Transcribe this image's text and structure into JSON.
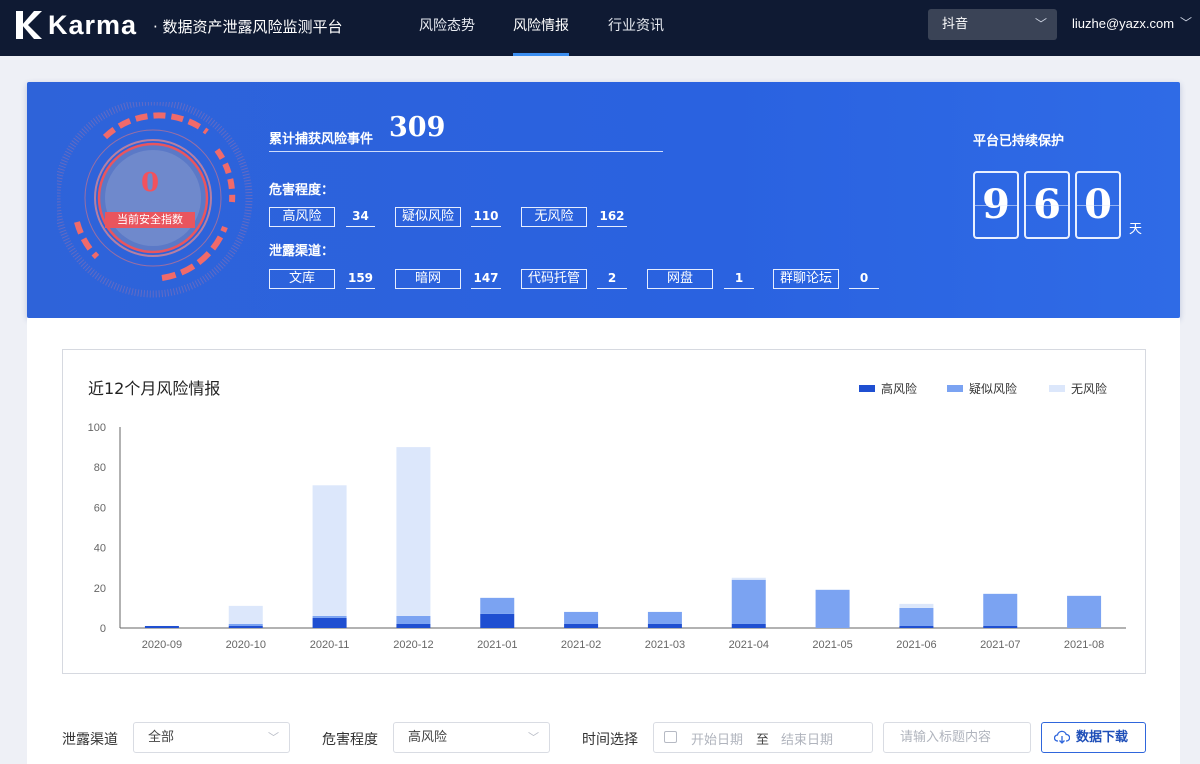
{
  "header": {
    "brand": "Karma",
    "subtitle": "· 数据资产泄露风险监测平台",
    "nav": [
      {
        "label": "风险态势",
        "active": false
      },
      {
        "label": "风险情报",
        "active": true
      },
      {
        "label": "行业资讯",
        "active": false
      }
    ],
    "app_select": "抖音",
    "user_email": "liuzhe@yazx.com"
  },
  "banner": {
    "safety_index_value": "0",
    "safety_index_label": "当前安全指数",
    "total_label": "累计捕获风险事件",
    "total_value": "309",
    "severity_label": "危害程度：",
    "severity": [
      {
        "label": "高风险",
        "value": "34"
      },
      {
        "label": "疑似风险",
        "value": "110"
      },
      {
        "label": "无风险",
        "value": "162"
      }
    ],
    "channel_label": "泄露渠道：",
    "channels": [
      {
        "label": "文库",
        "value": "159"
      },
      {
        "label": "暗网",
        "value": "147"
      },
      {
        "label": "代码托管",
        "value": "2"
      },
      {
        "label": "网盘",
        "value": "1"
      },
      {
        "label": "群聊论坛",
        "value": "0"
      }
    ],
    "protect_label": "平台已持续保护",
    "protect_digits": [
      "9",
      "6",
      "0"
    ],
    "protect_unit": "天"
  },
  "chart_data": {
    "type": "bar",
    "stacked": true,
    "title": "近12个月风险情报",
    "categories": [
      "2020-09",
      "2020-10",
      "2020-11",
      "2020-12",
      "2021-01",
      "2021-02",
      "2021-03",
      "2021-04",
      "2021-05",
      "2021-06",
      "2021-07",
      "2021-08"
    ],
    "series": [
      {
        "name": "高风险",
        "color": "#1f4fd1",
        "values": [
          1,
          1,
          5,
          2,
          7,
          2,
          2,
          2,
          0,
          1,
          1,
          0
        ]
      },
      {
        "name": "疑似风险",
        "color": "#7ba3f2",
        "values": [
          0,
          1,
          1,
          4,
          8,
          6,
          6,
          22,
          19,
          9,
          16,
          16
        ]
      },
      {
        "name": "无风险",
        "color": "#dce7fb",
        "values": [
          0,
          9,
          65,
          84,
          0,
          0,
          0,
          1,
          0,
          2,
          0,
          0
        ]
      }
    ],
    "yticks": [
      0,
      20,
      40,
      60,
      80,
      100
    ],
    "ylim": [
      0,
      100
    ],
    "legend_position": "top-right",
    "grid": false
  },
  "filters": {
    "channel_label": "泄露渠道",
    "channel_value": "全部",
    "severity_label": "危害程度",
    "severity_value": "高风险",
    "time_label": "时间选择",
    "start_placeholder": "开始日期",
    "range_sep": "至",
    "end_placeholder": "结束日期",
    "search_placeholder": "请输入标题内容",
    "download_label": "数据下载"
  }
}
